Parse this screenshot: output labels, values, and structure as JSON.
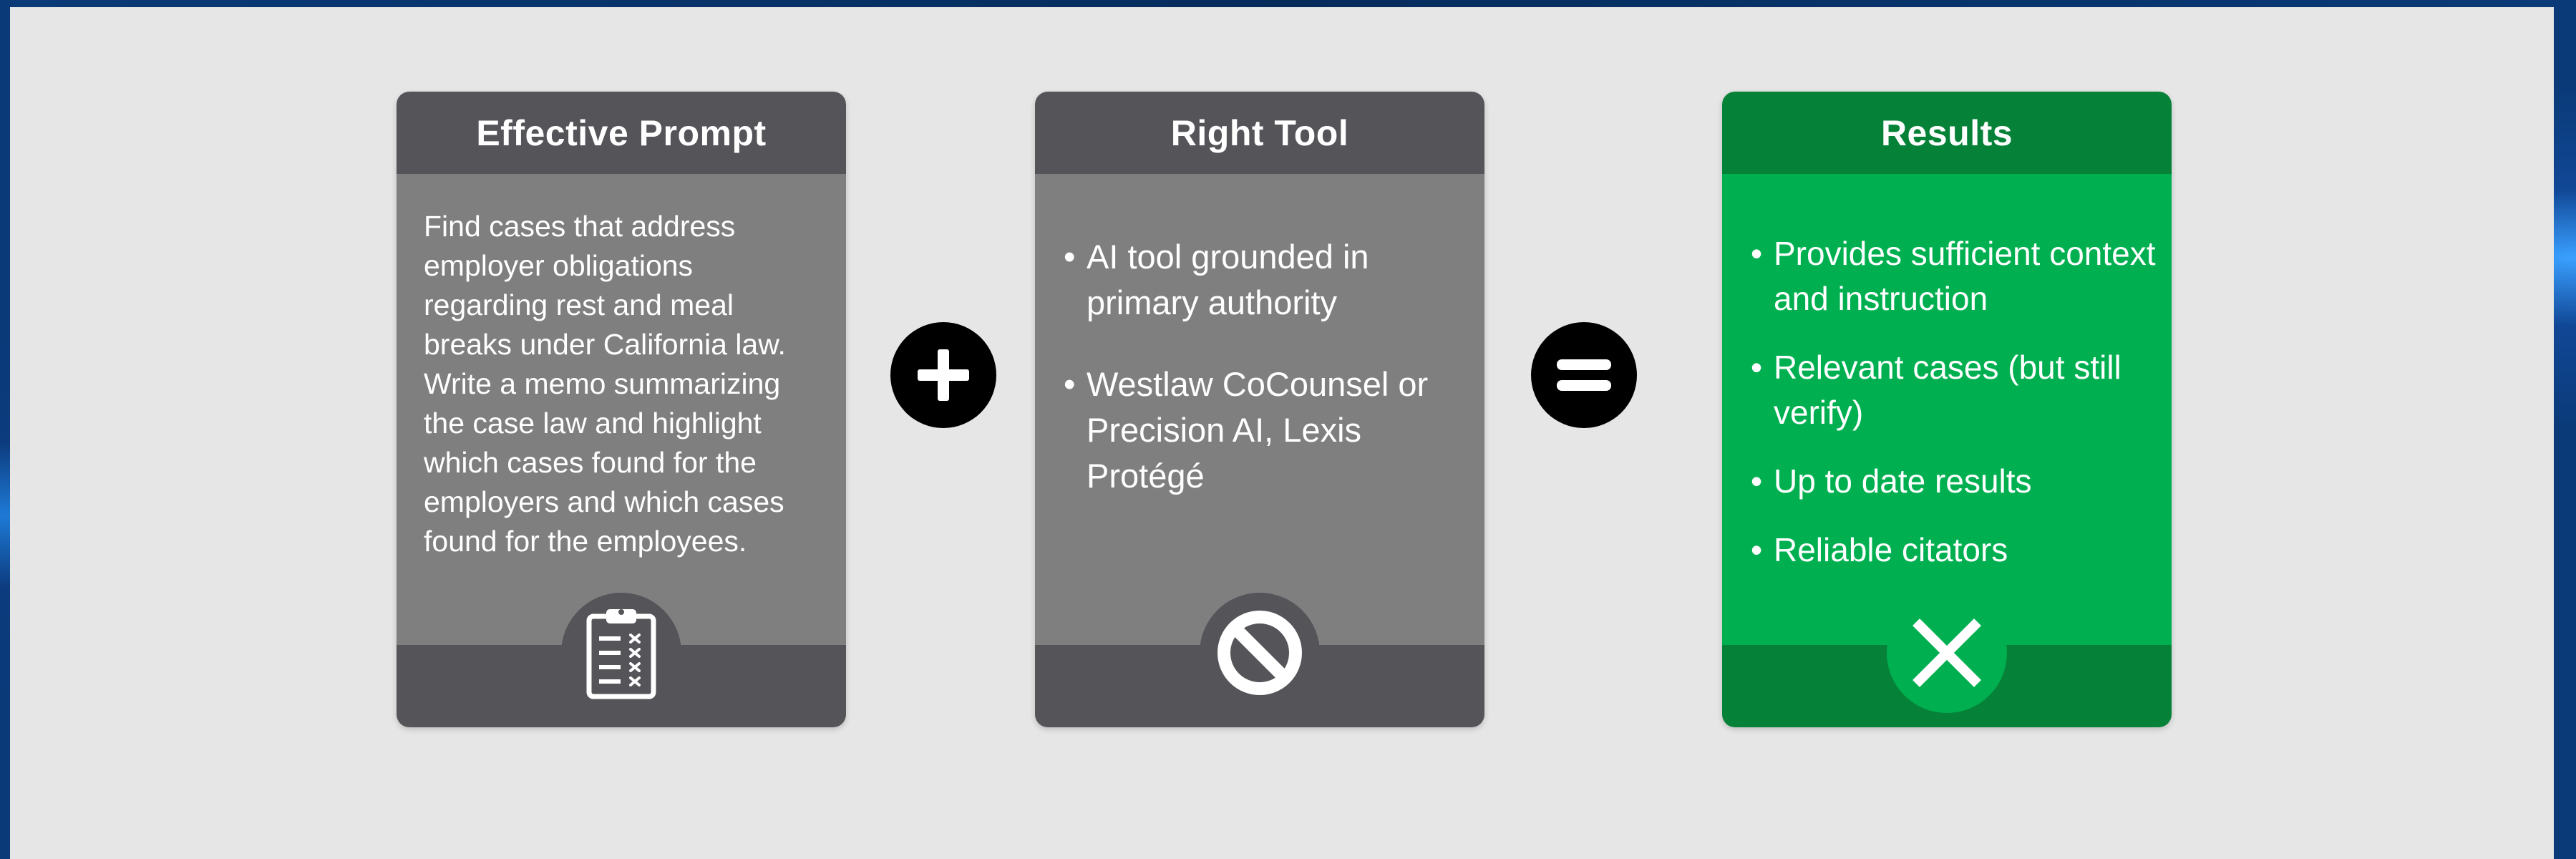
{
  "cards": {
    "prompt": {
      "title": "Effective Prompt",
      "text": "Find cases that address employer obligations regarding rest and meal breaks under California law. Write a memo summarizing the case law and highlight which cases found for the employers and which cases found for the employees.",
      "icon": "clipboard-checklist-icon"
    },
    "tool": {
      "title": "Right Tool",
      "bullets": [
        "AI tool grounded in primary authority",
        "Westlaw CoCounsel or Precision AI, Lexis Protégé"
      ],
      "icon": "prohibited-icon"
    },
    "results": {
      "title": "Results",
      "bullets": [
        "Provides sufficient context and instruction",
        "Relevant cases (but still verify)",
        "Up to date results",
        "Reliable citators"
      ],
      "icon": "close-x-icon"
    }
  },
  "operators": {
    "plus": "plus-icon",
    "equals": "equals-icon"
  },
  "colors": {
    "gray_header": "#545459",
    "gray_body": "#7f7f7f",
    "green_header": "#058237",
    "green_body": "#00b050",
    "slide_background": "#e6e6e6"
  }
}
